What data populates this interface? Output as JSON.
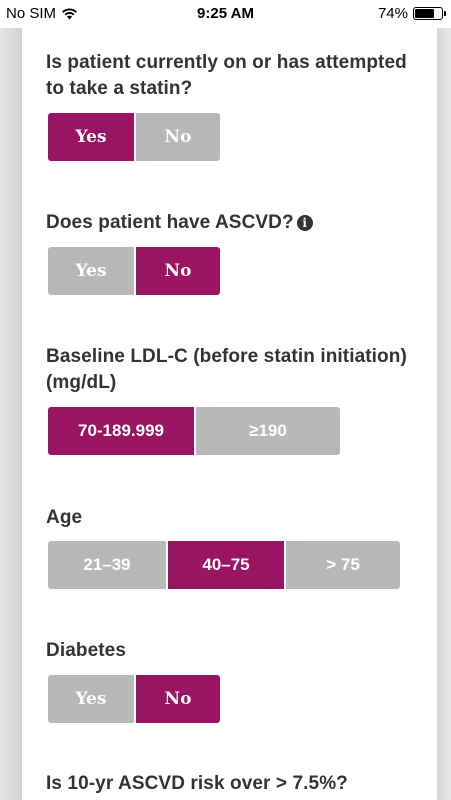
{
  "status_bar": {
    "carrier": "No SIM",
    "time": "9:25 AM",
    "battery_percent": "74%",
    "battery_level": 0.74
  },
  "colors": {
    "selected": "#9a1464",
    "unselected": "#b8b8b8",
    "question_text": "#333333"
  },
  "questions": {
    "statin": {
      "label": "Is patient currently on or has attempted to take a statin?",
      "options": [
        "Yes",
        "No"
      ],
      "selected": "Yes"
    },
    "ascvd": {
      "label": "Does patient have ASCVD?",
      "info_icon": "info-icon",
      "options": [
        "Yes",
        "No"
      ],
      "selected": "No"
    },
    "ldl": {
      "label": "Baseline LDL-C (before statin initiation) (mg/dL)",
      "options": [
        "70-189.999",
        "≥190"
      ],
      "selected": "70-189.999"
    },
    "age": {
      "label": "Age",
      "options": [
        "21–39",
        "40–75",
        "> 75"
      ],
      "selected": "40–75"
    },
    "diabetes": {
      "label": "Diabetes",
      "options": [
        "Yes",
        "No"
      ],
      "selected": "No"
    },
    "risk": {
      "label": "Is 10-yr ASCVD risk over > 7.5%?"
    }
  }
}
